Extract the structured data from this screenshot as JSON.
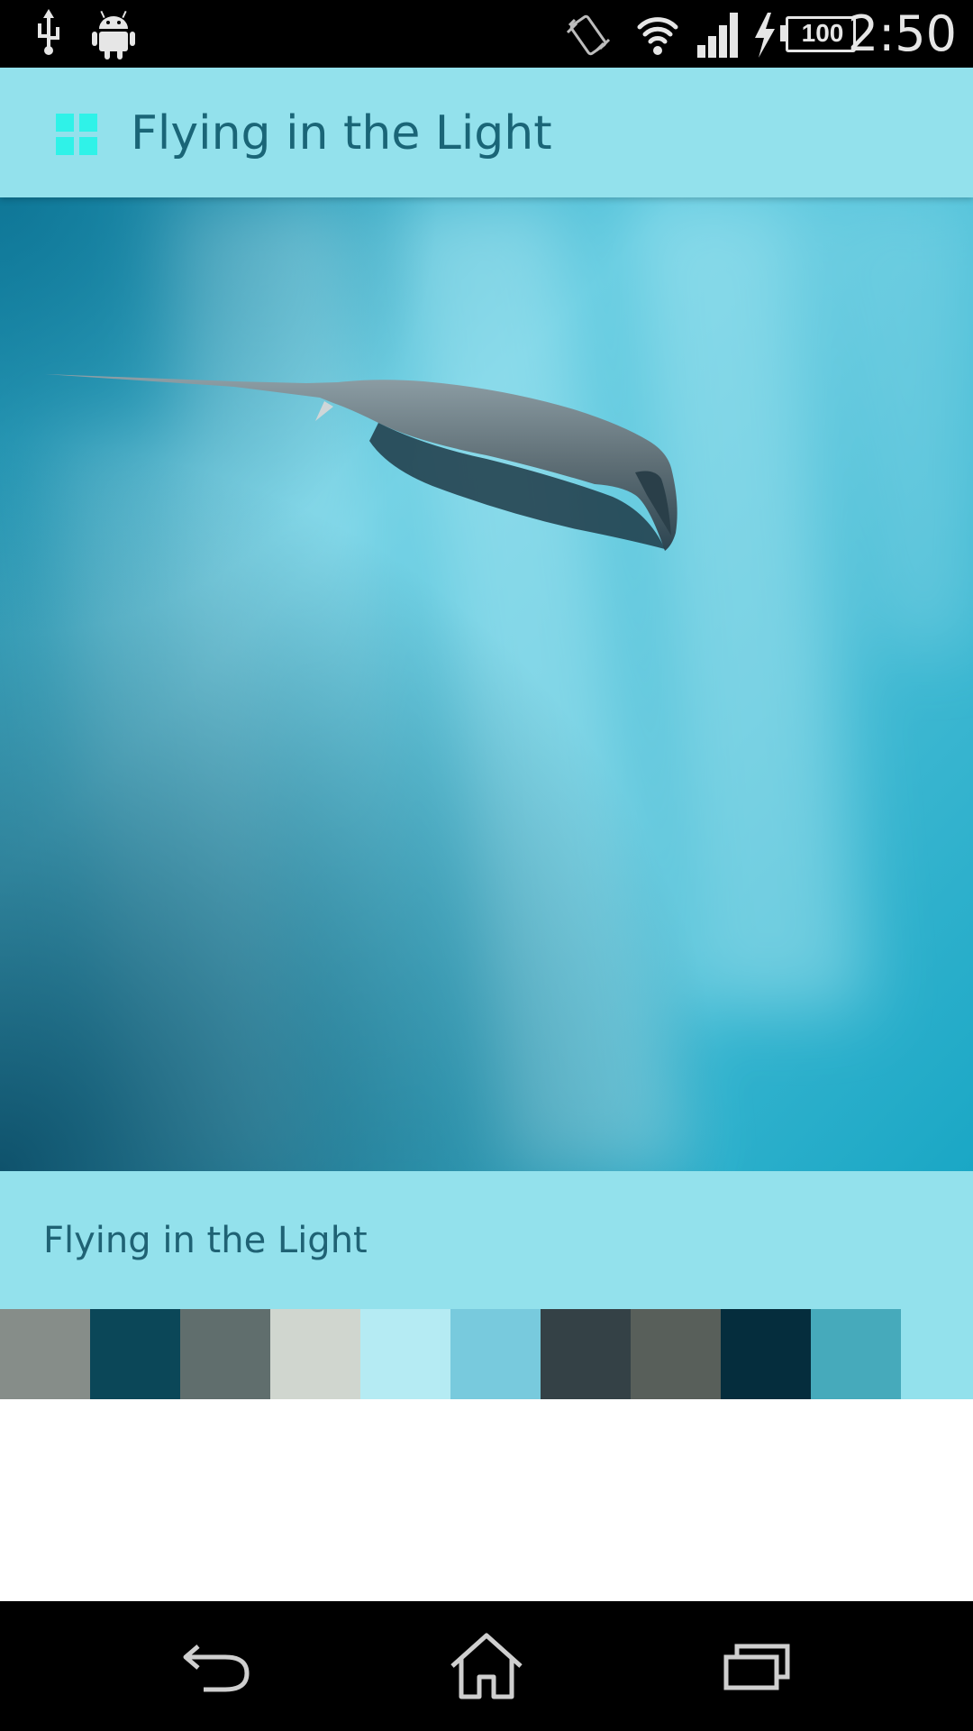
{
  "status_bar": {
    "time": "2:50",
    "battery_level": "100",
    "icons": [
      "usb-icon",
      "android-debug-icon",
      "vibrate-icon",
      "wifi-icon",
      "signal-icon",
      "charging-icon",
      "battery-icon"
    ]
  },
  "app_bar": {
    "title": "Flying in the Light",
    "icon": "palette-grid-icon",
    "icon_color": "#2ff2e8"
  },
  "photo": {
    "subject": "stingray-photo"
  },
  "caption": {
    "text": "Flying in the Light"
  },
  "palette": {
    "swatches": [
      "#868d89",
      "#0b4758",
      "#606e6d",
      "#d0d6cf",
      "#b5ebf3",
      "#78cadd",
      "#344146",
      "#585f5a",
      "#052d3d",
      "#46aabb"
    ]
  },
  "nav_bar": {
    "buttons": [
      "back-icon",
      "home-icon",
      "recent-apps-icon"
    ]
  },
  "colors": {
    "primary": "#93e1ec",
    "title_text": "#1a6577"
  }
}
